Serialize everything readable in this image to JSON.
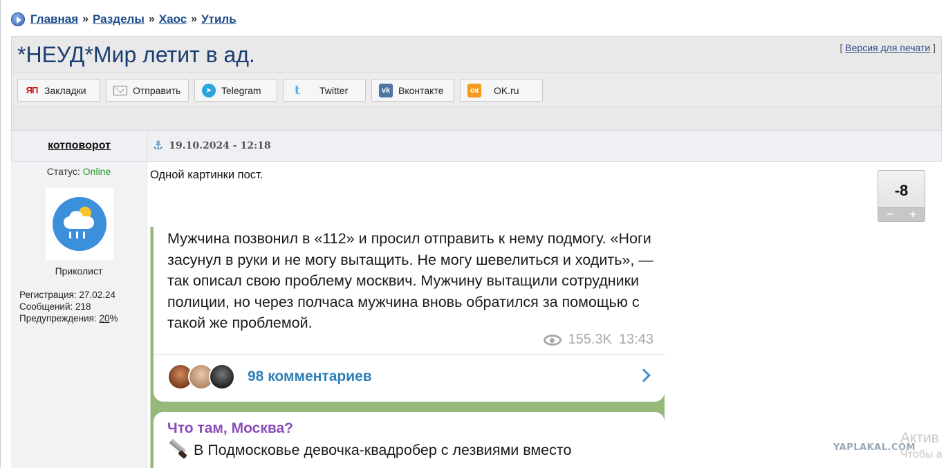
{
  "breadcrumb": {
    "items": [
      "Главная",
      "Разделы",
      "Хаос",
      "Утиль"
    ],
    "separator": "»"
  },
  "topic": {
    "title": "*НЕУД*Мир летит в ад.",
    "print_open": "[",
    "print_label": "Версия для печати",
    "print_close": "]"
  },
  "share": {
    "buttons": [
      {
        "label": "Закладки",
        "icon": "yap-icon",
        "glyph": "ЯП"
      },
      {
        "label": "Отправить",
        "icon": "mail-icon",
        "glyph": ""
      },
      {
        "label": "Telegram",
        "icon": "telegram-icon",
        "glyph": "➤"
      },
      {
        "label": "Twitter",
        "icon": "twitter-icon",
        "glyph": "t"
      },
      {
        "label": "Вконтакте",
        "icon": "vk-icon",
        "glyph": "vk"
      },
      {
        "label": "OK.ru",
        "icon": "ok-icon",
        "glyph": "ок"
      }
    ]
  },
  "post": {
    "author": "котповорот",
    "anchor_icon": "⚓",
    "date": "19.10.2024 - 12:18",
    "text": "Одной картинки пост.",
    "rating": "-8",
    "rating_minus": "−",
    "rating_plus": "+"
  },
  "user": {
    "status_label": "Статус:",
    "status_value": "Online",
    "rank": "Приколист",
    "registration": "Регистрация: 27.02.24",
    "messages": "Сообщений: 218",
    "warnings_label": "Предупреждения:",
    "warnings_value": "20",
    "warnings_unit": "%"
  },
  "embedded": {
    "message1": "Мужчина позвонил в «112» и просил отправить к нему подмогу. «Ноги засунул в руки и не могу вытащить. Не могу шевелиться и ходить», — так описал свою проблему москвич. Мужчину вытащили сотрудники полиции, но через полчаса мужчина вновь обратился за помощью с такой же проблемой.",
    "views": "155.3K",
    "time": "13:43",
    "comments": "98 комментариев",
    "channel": "Что там, Москва?",
    "message2_start": "В Подмосковье девочка-квадробер с лезвиями вместо"
  },
  "watermark": "YAPLAKAL.COM",
  "os_overlay": {
    "line1": "Актив",
    "line2": "Чтобы а"
  },
  "colors": {
    "link": "#1a4a8a",
    "online": "#2a9a2a",
    "title": "#1b3e70",
    "telegram_comments": "#2e80b8",
    "channel_name": "#8a4bb8"
  }
}
